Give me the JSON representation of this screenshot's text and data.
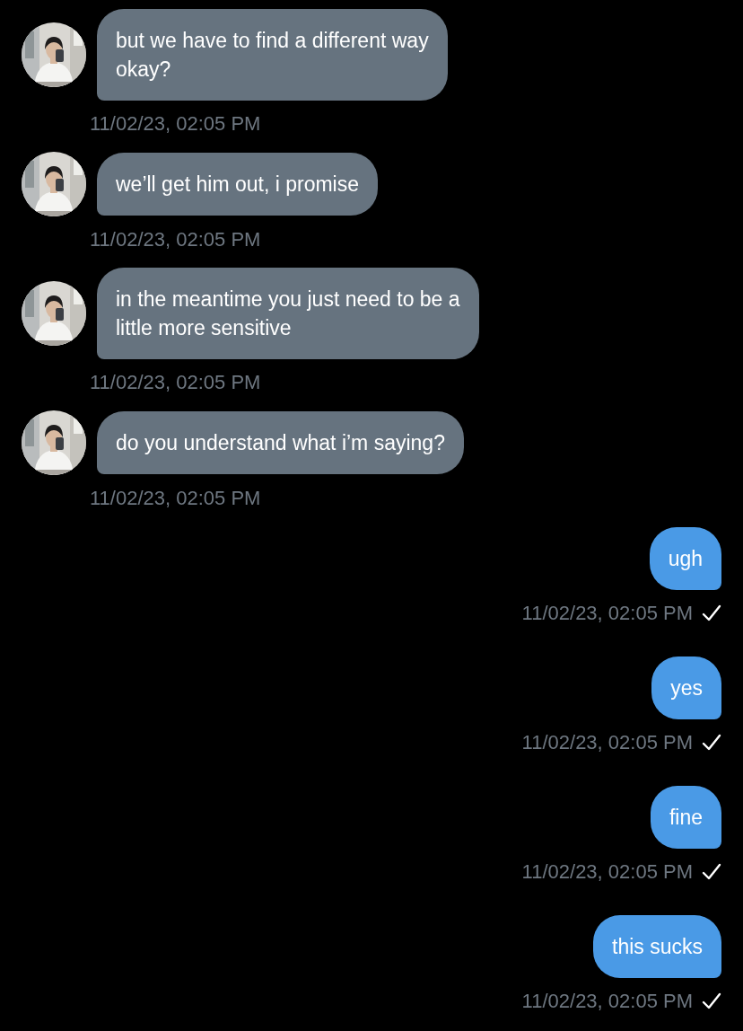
{
  "messages": [
    {
      "kind": "incoming",
      "lines": [
        "but we have to find a different way",
        "okay?"
      ],
      "time": "11/02/23, 02:05 PM"
    },
    {
      "kind": "incoming",
      "lines": [
        "we’ll get him out, i promise"
      ],
      "time": "11/02/23, 02:05 PM"
    },
    {
      "kind": "incoming",
      "lines": [
        "in the meantime you just need to be a",
        "little more sensitive"
      ],
      "time": "11/02/23, 02:05 PM"
    },
    {
      "kind": "incoming",
      "lines": [
        "do you understand what i’m saying?"
      ],
      "time": "11/02/23, 02:05 PM"
    },
    {
      "kind": "outgoing",
      "lines": [
        "ugh"
      ],
      "time": "11/02/23, 02:05 PM",
      "read": true
    },
    {
      "kind": "outgoing",
      "lines": [
        "yes"
      ],
      "time": "11/02/23, 02:05 PM",
      "read": true
    },
    {
      "kind": "outgoing",
      "lines": [
        "fine"
      ],
      "time": "11/02/23, 02:05 PM",
      "read": true
    },
    {
      "kind": "outgoing",
      "lines": [
        "this sucks"
      ],
      "time": "11/02/23, 02:05 PM",
      "read": true
    }
  ]
}
